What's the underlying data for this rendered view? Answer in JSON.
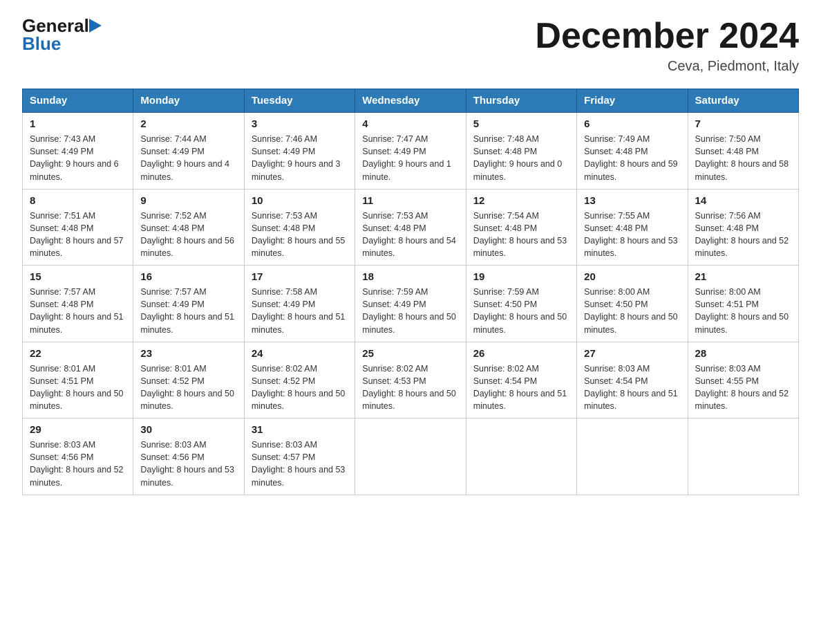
{
  "logo": {
    "general": "General",
    "blue": "Blue"
  },
  "title": "December 2024",
  "location": "Ceva, Piedmont, Italy",
  "days_header": [
    "Sunday",
    "Monday",
    "Tuesday",
    "Wednesday",
    "Thursday",
    "Friday",
    "Saturday"
  ],
  "weeks": [
    [
      {
        "day": "1",
        "sunrise": "Sunrise: 7:43 AM",
        "sunset": "Sunset: 4:49 PM",
        "daylight": "Daylight: 9 hours and 6 minutes."
      },
      {
        "day": "2",
        "sunrise": "Sunrise: 7:44 AM",
        "sunset": "Sunset: 4:49 PM",
        "daylight": "Daylight: 9 hours and 4 minutes."
      },
      {
        "day": "3",
        "sunrise": "Sunrise: 7:46 AM",
        "sunset": "Sunset: 4:49 PM",
        "daylight": "Daylight: 9 hours and 3 minutes."
      },
      {
        "day": "4",
        "sunrise": "Sunrise: 7:47 AM",
        "sunset": "Sunset: 4:49 PM",
        "daylight": "Daylight: 9 hours and 1 minute."
      },
      {
        "day": "5",
        "sunrise": "Sunrise: 7:48 AM",
        "sunset": "Sunset: 4:48 PM",
        "daylight": "Daylight: 9 hours and 0 minutes."
      },
      {
        "day": "6",
        "sunrise": "Sunrise: 7:49 AM",
        "sunset": "Sunset: 4:48 PM",
        "daylight": "Daylight: 8 hours and 59 minutes."
      },
      {
        "day": "7",
        "sunrise": "Sunrise: 7:50 AM",
        "sunset": "Sunset: 4:48 PM",
        "daylight": "Daylight: 8 hours and 58 minutes."
      }
    ],
    [
      {
        "day": "8",
        "sunrise": "Sunrise: 7:51 AM",
        "sunset": "Sunset: 4:48 PM",
        "daylight": "Daylight: 8 hours and 57 minutes."
      },
      {
        "day": "9",
        "sunrise": "Sunrise: 7:52 AM",
        "sunset": "Sunset: 4:48 PM",
        "daylight": "Daylight: 8 hours and 56 minutes."
      },
      {
        "day": "10",
        "sunrise": "Sunrise: 7:53 AM",
        "sunset": "Sunset: 4:48 PM",
        "daylight": "Daylight: 8 hours and 55 minutes."
      },
      {
        "day": "11",
        "sunrise": "Sunrise: 7:53 AM",
        "sunset": "Sunset: 4:48 PM",
        "daylight": "Daylight: 8 hours and 54 minutes."
      },
      {
        "day": "12",
        "sunrise": "Sunrise: 7:54 AM",
        "sunset": "Sunset: 4:48 PM",
        "daylight": "Daylight: 8 hours and 53 minutes."
      },
      {
        "day": "13",
        "sunrise": "Sunrise: 7:55 AM",
        "sunset": "Sunset: 4:48 PM",
        "daylight": "Daylight: 8 hours and 53 minutes."
      },
      {
        "day": "14",
        "sunrise": "Sunrise: 7:56 AM",
        "sunset": "Sunset: 4:48 PM",
        "daylight": "Daylight: 8 hours and 52 minutes."
      }
    ],
    [
      {
        "day": "15",
        "sunrise": "Sunrise: 7:57 AM",
        "sunset": "Sunset: 4:48 PM",
        "daylight": "Daylight: 8 hours and 51 minutes."
      },
      {
        "day": "16",
        "sunrise": "Sunrise: 7:57 AM",
        "sunset": "Sunset: 4:49 PM",
        "daylight": "Daylight: 8 hours and 51 minutes."
      },
      {
        "day": "17",
        "sunrise": "Sunrise: 7:58 AM",
        "sunset": "Sunset: 4:49 PM",
        "daylight": "Daylight: 8 hours and 51 minutes."
      },
      {
        "day": "18",
        "sunrise": "Sunrise: 7:59 AM",
        "sunset": "Sunset: 4:49 PM",
        "daylight": "Daylight: 8 hours and 50 minutes."
      },
      {
        "day": "19",
        "sunrise": "Sunrise: 7:59 AM",
        "sunset": "Sunset: 4:50 PM",
        "daylight": "Daylight: 8 hours and 50 minutes."
      },
      {
        "day": "20",
        "sunrise": "Sunrise: 8:00 AM",
        "sunset": "Sunset: 4:50 PM",
        "daylight": "Daylight: 8 hours and 50 minutes."
      },
      {
        "day": "21",
        "sunrise": "Sunrise: 8:00 AM",
        "sunset": "Sunset: 4:51 PM",
        "daylight": "Daylight: 8 hours and 50 minutes."
      }
    ],
    [
      {
        "day": "22",
        "sunrise": "Sunrise: 8:01 AM",
        "sunset": "Sunset: 4:51 PM",
        "daylight": "Daylight: 8 hours and 50 minutes."
      },
      {
        "day": "23",
        "sunrise": "Sunrise: 8:01 AM",
        "sunset": "Sunset: 4:52 PM",
        "daylight": "Daylight: 8 hours and 50 minutes."
      },
      {
        "day": "24",
        "sunrise": "Sunrise: 8:02 AM",
        "sunset": "Sunset: 4:52 PM",
        "daylight": "Daylight: 8 hours and 50 minutes."
      },
      {
        "day": "25",
        "sunrise": "Sunrise: 8:02 AM",
        "sunset": "Sunset: 4:53 PM",
        "daylight": "Daylight: 8 hours and 50 minutes."
      },
      {
        "day": "26",
        "sunrise": "Sunrise: 8:02 AM",
        "sunset": "Sunset: 4:54 PM",
        "daylight": "Daylight: 8 hours and 51 minutes."
      },
      {
        "day": "27",
        "sunrise": "Sunrise: 8:03 AM",
        "sunset": "Sunset: 4:54 PM",
        "daylight": "Daylight: 8 hours and 51 minutes."
      },
      {
        "day": "28",
        "sunrise": "Sunrise: 8:03 AM",
        "sunset": "Sunset: 4:55 PM",
        "daylight": "Daylight: 8 hours and 52 minutes."
      }
    ],
    [
      {
        "day": "29",
        "sunrise": "Sunrise: 8:03 AM",
        "sunset": "Sunset: 4:56 PM",
        "daylight": "Daylight: 8 hours and 52 minutes."
      },
      {
        "day": "30",
        "sunrise": "Sunrise: 8:03 AM",
        "sunset": "Sunset: 4:56 PM",
        "daylight": "Daylight: 8 hours and 53 minutes."
      },
      {
        "day": "31",
        "sunrise": "Sunrise: 8:03 AM",
        "sunset": "Sunset: 4:57 PM",
        "daylight": "Daylight: 8 hours and 53 minutes."
      },
      null,
      null,
      null,
      null
    ]
  ]
}
